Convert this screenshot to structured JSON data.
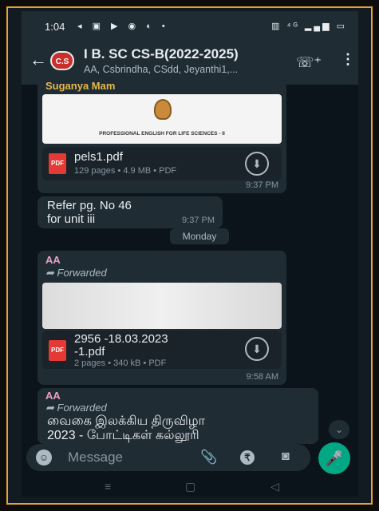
{
  "status_bar": {
    "time": "1:04",
    "left_icons": "◂ ▣ ▶ ◉ ◐ •",
    "right_icons": "▥ ⁴ᴳ ▂▄▆ ▭"
  },
  "header": {
    "back_glyph": "←",
    "avatar_text": "C.S",
    "title": "I B. SC CS-B(2022-2025)",
    "subtitle": "AA, Csbrindha, CSdd, Jeyanthi1,...",
    "call_glyph": "☏⁺",
    "more_glyph": "⋮"
  },
  "messages": [
    {
      "sender": "Suganya Mam",
      "doc_title": "PROFESSIONAL ENGLISH FOR LIFE SCIENCES - II",
      "file_name": "pels1.pdf",
      "file_meta": "129 pages • 4.9 MB • PDF",
      "time": "9:37 PM"
    },
    {
      "text_line1": "Refer pg. No 46",
      "text_line2": "for unit iii",
      "time": "9:37 PM"
    },
    {
      "sender": "AA",
      "forwarded": "Forwarded",
      "file_name_line1": "2956 -18.03.2023",
      "file_name_line2": "-1.pdf",
      "file_meta": "2 pages • 340 kB • PDF",
      "time": "9:58 AM"
    },
    {
      "sender": "AA",
      "forwarded": "Forwarded",
      "text_line1": "வைகை இலக்கிய திருவிழா",
      "text_line2": "2023 - போட்டிகள் கல்லூரி"
    }
  ],
  "day_chip": "Monday",
  "composer": {
    "placeholder": "Message",
    "emoji_glyph": "☺",
    "attach_glyph": "📎",
    "rupee_glyph": "₹",
    "camera_glyph": "◙",
    "mic_glyph": "🎤"
  },
  "scroll_down_glyph": "⌄",
  "pdf_label": "PDF",
  "download_glyph": "⬇",
  "forward_glyph": "➦",
  "nav": {
    "menu": "≡",
    "home": "▢",
    "back": "◁"
  },
  "colors": {
    "accent": "#00a884",
    "sender_yellow": "#e5b84b",
    "sender_pink": "#e9a0c4",
    "frame": "#e8a13a"
  }
}
